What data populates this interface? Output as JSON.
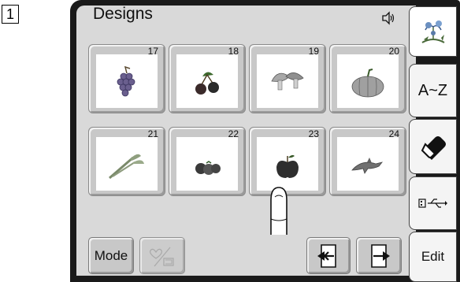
{
  "step_number": "1",
  "header": {
    "title": "Designs",
    "sound_icon": "speaker-icon"
  },
  "designs": [
    {
      "number": "17",
      "icon": "grapes-icon"
    },
    {
      "number": "18",
      "icon": "cherries-icon"
    },
    {
      "number": "19",
      "icon": "mushrooms-icon"
    },
    {
      "number": "20",
      "icon": "pumpkin-icon"
    },
    {
      "number": "21",
      "icon": "celery-icon"
    },
    {
      "number": "22",
      "icon": "tomatoes-icon"
    },
    {
      "number": "23",
      "icon": "apple-icon"
    },
    {
      "number": "24",
      "icon": "dolphin-icon"
    }
  ],
  "side_tabs": [
    {
      "icon": "flower-design-icon",
      "label": ""
    },
    {
      "label": "A~Z"
    },
    {
      "icon": "eraser-icon",
      "label": ""
    },
    {
      "icon": "usb-icon",
      "label": ""
    },
    {
      "label": "Edit"
    }
  ],
  "footer": {
    "mode_label": "Mode",
    "favorite_icon": "heart-memory-icon",
    "prev_icon": "arrow-left-icon",
    "next_icon": "arrow-right-icon"
  },
  "colors": {
    "panel": "#d9d9d9",
    "frame": "#1a1a1a",
    "tile": "#c8c8c8"
  }
}
